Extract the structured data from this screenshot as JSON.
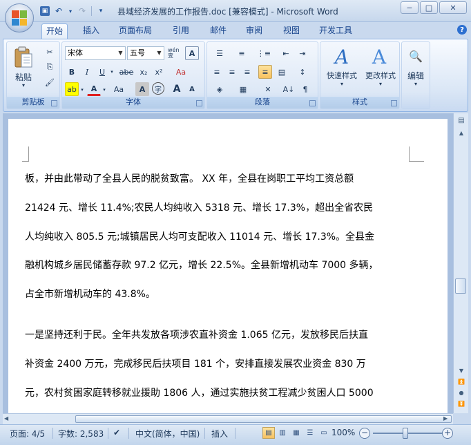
{
  "window": {
    "title": "县域经济发展的工作报告.doc [兼容模式] - Microsoft Word",
    "minimize": "−",
    "maximize": "□",
    "close": "✕"
  },
  "qat": {
    "save": "💾",
    "undo": "↶",
    "redo": "↷",
    "customize": "▾"
  },
  "tabs": [
    {
      "label": "开始",
      "active": true
    },
    {
      "label": "插入",
      "active": false
    },
    {
      "label": "页面布局",
      "active": false
    },
    {
      "label": "引用",
      "active": false
    },
    {
      "label": "邮件",
      "active": false
    },
    {
      "label": "审阅",
      "active": false
    },
    {
      "label": "视图",
      "active": false
    },
    {
      "label": "开发工具",
      "active": false
    }
  ],
  "help": "?",
  "ribbon": {
    "clipboard": {
      "label": "剪贴板",
      "paste_label": "粘贴",
      "paste_arrow": "▾",
      "cut": "✂",
      "copy": "⎘",
      "format_painter": "🖌"
    },
    "font": {
      "label": "字体",
      "font_name": "宋体",
      "font_size": "五号",
      "phonetic": "wén变",
      "char_border": "A",
      "bold": "B",
      "italic": "I",
      "underline": "U",
      "strike": "abe",
      "subscript": "x₂",
      "superscript": "x²",
      "clear_format": "Aa",
      "highlight": "ab",
      "font_color": "A",
      "change_case": "Aa",
      "char_shading": "A",
      "enclose": "字",
      "grow": "A",
      "shrink": "A"
    },
    "paragraph": {
      "label": "段落",
      "bullets": "☰",
      "numbering": "≡",
      "multilevel": "⋮≡",
      "decrease_indent": "⇤",
      "increase_indent": "⇥",
      "align_left": "≡",
      "center": "≡",
      "align_right": "≡",
      "justify": "≡",
      "distributed": "▤",
      "line_spacing": "↕",
      "shading": "◈",
      "borders": "▦",
      "chinese_layout": "✕",
      "sort": "A↓",
      "show_marks": "¶"
    },
    "styles": {
      "label": "样式",
      "quick_styles": "快速样式",
      "change_styles": "更改样式"
    },
    "editing": {
      "label": "编辑",
      "find": "🔍"
    }
  },
  "document": {
    "lines": [
      "板，并由此带动了全县人民的脱贫致富。 XX 年，全县在岗职工平均工资总额",
      "21424 元、增长 11.4%;农民人均纯收入 5318 元、增长 17.3%，超出全省农民",
      "人均纯收入 805.5 元;城镇居民人均可支配收入 11014 元、增长 17.3%。全县金",
      "融机构城乡居民储蓄存款 97.2 亿元，增长 22.5%。全县新增机动车 7000 多辆，",
      "占全市新增机动车的 43.8%。",
      "一是坚持还利于民。全年共发放各项涉农直补资金 1.065 亿元，发放移民后扶直",
      "补资金 2400 万元，完成移民后扶项目 181 个，安排直接发展农业资金 830 万",
      "元，农村贫困家庭转移就业援助 1806 人，通过实施扶贫工程减少贫困人口 5000"
    ]
  },
  "status": {
    "page": "页面: 4/5",
    "words": "字数: 2,583",
    "language": "中文(简体，中国)",
    "mode": "插入",
    "zoom": "100%",
    "zoom_out": "−",
    "zoom_in": "+"
  }
}
